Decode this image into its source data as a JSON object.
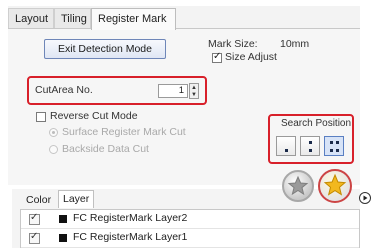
{
  "tabs": [
    {
      "label": "Layout"
    },
    {
      "label": "Tiling"
    },
    {
      "label": "Register Mark"
    }
  ],
  "exit_button": "Exit Detection Mode",
  "mark_size": {
    "label": "Mark Size:",
    "value": "10mm"
  },
  "size_adjust": {
    "label": "Size Adjust",
    "checked": true
  },
  "cut_area": {
    "label": "CutArea No.",
    "value": "1"
  },
  "reverse_cut": {
    "label": "Reverse Cut Mode",
    "checked": false
  },
  "radio_options": [
    {
      "label": "Surface Register Mark Cut",
      "selected": true
    },
    {
      "label": "Backside Data Cut",
      "selected": false
    }
  ],
  "search_position": {
    "label": "Search Position",
    "options_dots": [
      1,
      4,
      6
    ],
    "active_index": 2
  },
  "lower_tabs": [
    {
      "label": "Color"
    },
    {
      "label": "Layer"
    }
  ],
  "layers": [
    {
      "name": "FC RegisterMark Layer2"
    },
    {
      "name": "FC RegisterMark Layer1"
    }
  ]
}
